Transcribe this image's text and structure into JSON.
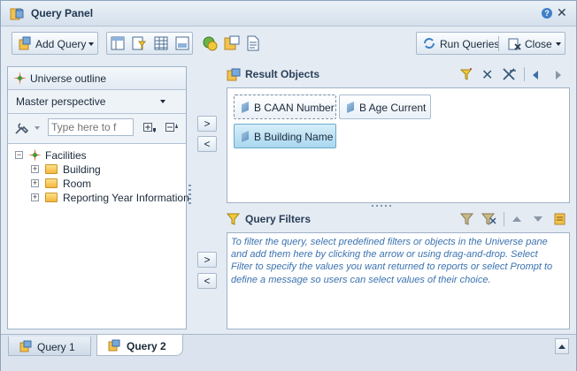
{
  "window": {
    "title": "Query Panel",
    "help_label": "?",
    "close_glyph": "✕"
  },
  "toolbar": {
    "add_query_label": "Add Query",
    "run_queries_label": "Run Queries",
    "close_label": "Close"
  },
  "universe": {
    "outline_label": "Universe outline",
    "perspective_value": "Master perspective",
    "search_placeholder": "Type here to f",
    "tree": {
      "root": "Facilities",
      "children": [
        "Building",
        "Room",
        "Reporting Year Information"
      ]
    }
  },
  "result_objects": {
    "title": "Result Objects",
    "items": [
      "B CAAN Number",
      "B Age Current",
      "B Building Name"
    ]
  },
  "move": {
    "add_glyph": ">",
    "remove_glyph": "<"
  },
  "query_filters": {
    "title": "Query Filters",
    "help_text": "To filter the query, select predefined filters or objects in the Universe pane and add them here by clicking the arrow or using drag-and-drop. Select Filter to specify the values you want returned to reports or select Prompt to define a message so users can select values of their choice."
  },
  "tabs": [
    "Query 1",
    "Query 2"
  ],
  "colors": {
    "accent": "#3f7fc8",
    "selected_object": "#a9d7ef",
    "filter_text": "#3b72b0",
    "folder": "#f2b73b"
  }
}
